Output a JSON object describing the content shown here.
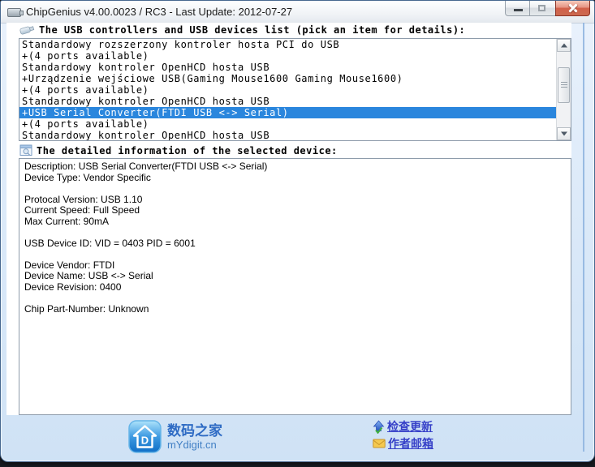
{
  "window": {
    "title": "ChipGenius v4.00.0023 / RC3 - Last Update: 2012-07-27"
  },
  "headers": {
    "device_list": "The USB controllers and USB devices list (pick an item for details):",
    "details": "The detailed information of the selected device:"
  },
  "device_list": {
    "items": [
      {
        "text": "Standardowy rozszerzony kontroler hosta PCI do USB",
        "selected": false
      },
      {
        "text": "+(4 ports available)",
        "selected": false
      },
      {
        "text": "Standardowy kontroler OpenHCD hosta USB",
        "selected": false
      },
      {
        "text": "+Urządzenie wejściowe USB(Gaming Mouse1600 Gaming Mouse1600)",
        "selected": false
      },
      {
        "text": "+(4 ports available)",
        "selected": false
      },
      {
        "text": "Standardowy kontroler OpenHCD hosta USB",
        "selected": false
      },
      {
        "text": "+USB Serial Converter(FTDI USB <-> Serial)",
        "selected": true
      },
      {
        "text": "+(4 ports available)",
        "selected": false
      },
      {
        "text": "Standardowy kontroler OpenHCD hosta USB",
        "selected": false
      }
    ]
  },
  "details": {
    "lines": [
      "Description: USB Serial Converter(FTDI USB <-> Serial)",
      "Device Type: Vendor Specific",
      "",
      "Protocal Version: USB 1.10",
      "Current Speed: Full Speed",
      "Max Current: 90mA",
      "",
      "USB Device ID: VID = 0403 PID = 6001",
      "",
      "Device Vendor: FTDI",
      "Device Name: USB <-> Serial",
      "Device Revision: 0400",
      "",
      "Chip Part-Number: Unknown"
    ]
  },
  "footer": {
    "logo": {
      "title": "数码之家",
      "subtitle": "mYdigit.cn"
    },
    "links": [
      {
        "label": "检查更新",
        "icon": "update-arrow-icon"
      },
      {
        "label": "作者邮箱",
        "icon": "mail-icon"
      }
    ]
  },
  "colors": {
    "selection_bg": "#2a86dd",
    "selection_text": "#ffffff",
    "link": "#3640c8",
    "logo_title": "#2e6bc4",
    "logo_subtitle": "#417fc4",
    "close_button": "#cc6950",
    "logo_badge": "#2186d8"
  }
}
